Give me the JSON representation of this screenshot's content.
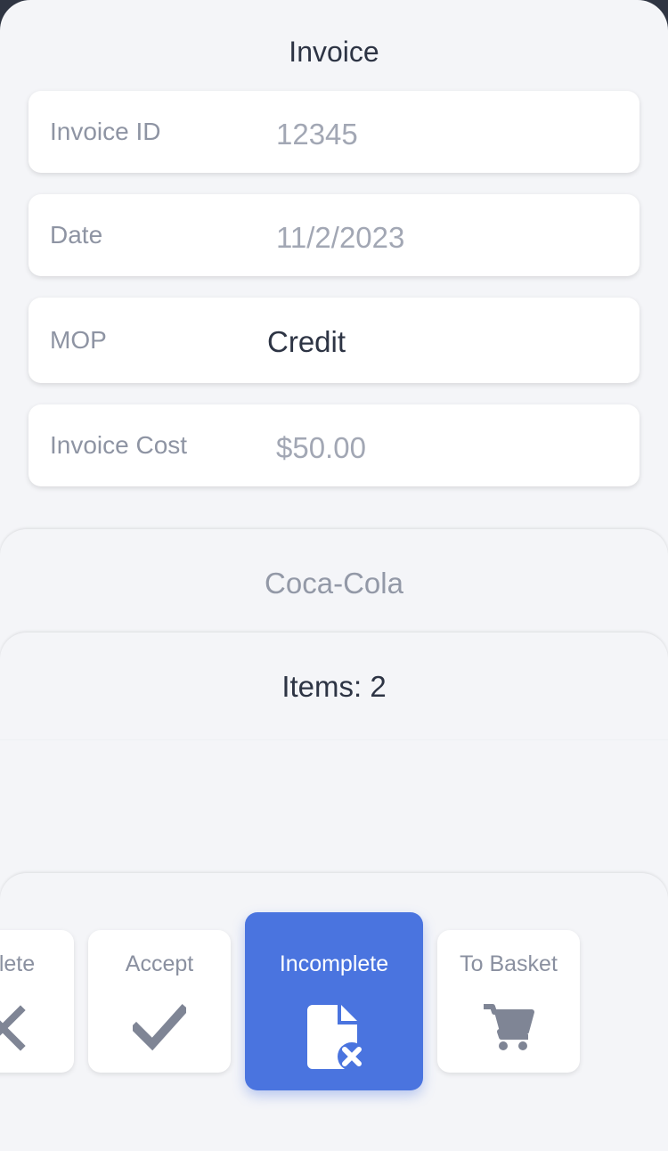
{
  "header": {
    "title": "Invoice"
  },
  "fields": [
    {
      "label": "Invoice ID",
      "value": "12345"
    },
    {
      "label": "Date",
      "value": "11/2/2023"
    },
    {
      "label": "MOP",
      "value": "Credit"
    },
    {
      "label": "Invoice Cost",
      "value": "$50.00"
    }
  ],
  "vendor": {
    "name": "Coca-Cola"
  },
  "items": {
    "summary": "Items: 2"
  },
  "actions": [
    {
      "label": "Delete",
      "visible_label": "lete",
      "icon": "x-icon"
    },
    {
      "label": "Accept",
      "icon": "check-icon"
    },
    {
      "label": "Incomplete",
      "icon": "file-x-icon",
      "active": true
    },
    {
      "label": "To Basket",
      "icon": "cart-icon"
    }
  ],
  "colors": {
    "accent": "#4a74df",
    "background": "#f4f5f8",
    "text_dark": "#2d3444",
    "text_muted": "#8e94a3"
  }
}
